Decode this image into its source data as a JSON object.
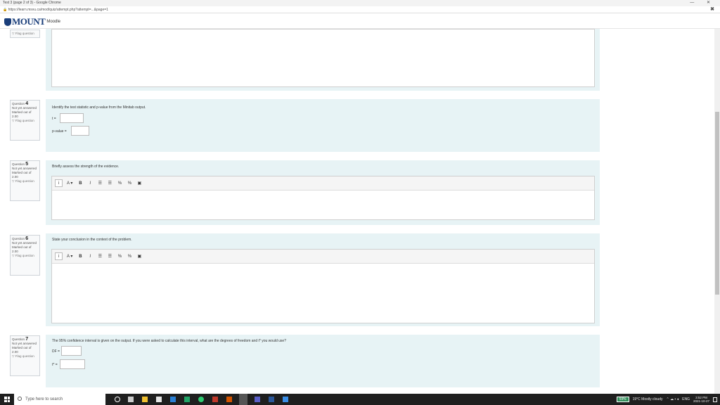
{
  "browser": {
    "title": "Test 3 (page 2 of 3) - Google Chrome",
    "window_controls": "— ✕",
    "url": "https://learn.msvu.ca/mod/quiz/attempt.php?attempt=...&page=1"
  },
  "site": {
    "logo_text": "MOUNT",
    "logo_sub": "Moodle"
  },
  "questions": [
    {
      "number": "4",
      "status": "Not yet answered",
      "marks": "Marked out of 2.00",
      "flag": "Flag question",
      "text": "Identify the test statistic and p-value from the Minitab output.",
      "fields": [
        {
          "label": "t ="
        },
        {
          "label": "p-value ="
        }
      ]
    },
    {
      "number": "5",
      "status": "Not yet answered",
      "marks": "Marked out of 2.00",
      "flag": "Flag question",
      "text": "Briefly assess the strength of the evidence."
    },
    {
      "number": "6",
      "status": "Not yet answered",
      "marks": "Marked out of 2.00",
      "flag": "Flag question",
      "text": "State your conclusion in the context of the problem."
    },
    {
      "number": "7",
      "status": "Not yet answered",
      "marks": "Marked out of 2.00",
      "flag": "Flag question",
      "text": "The 95% confidence interval is given on the output. If you were asked to calculate this interval, what are the degrees of freedom and t* you would use?",
      "fields": [
        {
          "label": "DF ="
        },
        {
          "label": "t* ="
        }
      ]
    }
  ],
  "prev_flag": "Flag question",
  "editor_toolbar": [
    "i",
    "A ▾",
    "B",
    "I",
    "☰",
    "☰",
    "%",
    "%",
    "▣"
  ],
  "taskbar": {
    "search_placeholder": "Type here to search",
    "battery": "59%",
    "weather": "19°C  Mostly cloudy",
    "lang": "ENG",
    "time": "3:52 PM",
    "date": "2021-10-27"
  }
}
